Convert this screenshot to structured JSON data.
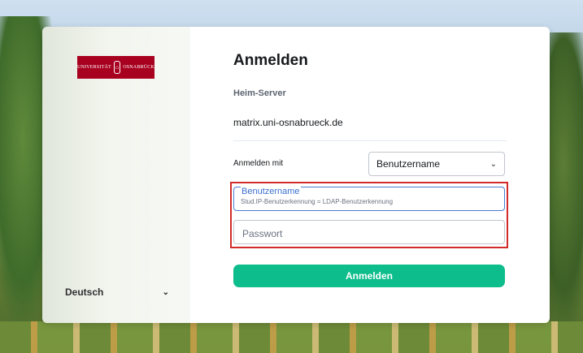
{
  "branding": {
    "logo_text_left": "UNIVERSITÄT",
    "logo_text_right": "OSNABRÜCK"
  },
  "sidebar": {
    "language": "Deutsch"
  },
  "login": {
    "title": "Anmelden",
    "homeserver_label": "Heim-Server",
    "homeserver_value": "matrix.uni-osnabrueck.de",
    "login_with_label": "Anmelden mit",
    "login_with_value": "Benutzername",
    "username_label": "Benutzername",
    "username_placeholder": "Stud.IP-Benutzerkennung = LDAP-Benutzerkennung",
    "password_placeholder": "Passwort",
    "submit_label": "Anmelden"
  },
  "icons": {
    "chevron": "chevron-down-icon"
  },
  "colors": {
    "accent": "#0dbd8b",
    "brand": "#a8001f",
    "highlight": "#d12b2b",
    "focus": "#3a6fce"
  }
}
